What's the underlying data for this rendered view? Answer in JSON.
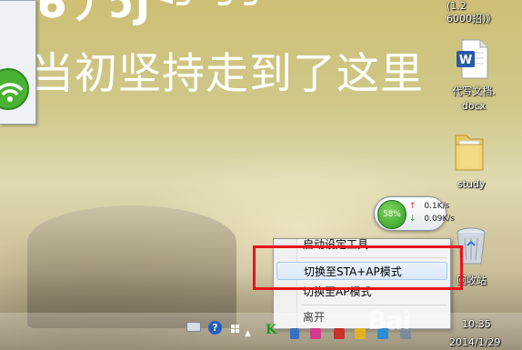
{
  "wallpaper": {
    "headline_partial": "ᑲ丿ɔJᑉ╯ ╯╯",
    "slogan": "当初坚持走到了这里"
  },
  "desktop": {
    "top_right_label_line1": "(1.2",
    "top_right_label_line2": "6000招)》",
    "icons": [
      {
        "label_line1": "代写文档.",
        "label_line2": "docx",
        "icon": "word-document-icon"
      },
      {
        "label_line1": "study",
        "icon": "folder-icon"
      },
      {
        "label_line1": "回收站",
        "icon": "recycle-bin-icon"
      }
    ]
  },
  "network_widget": {
    "percent": "58%",
    "upload": "0.1K/s",
    "download": "0.09K/s",
    "colors": {
      "ring": "#2c9a22",
      "up_arrow": "#e02020",
      "down_arrow": "#2e9d2e"
    }
  },
  "context_menu": {
    "items": [
      {
        "label": "启动设定工具",
        "highlight": false
      },
      {
        "label": "切换至STA+AP模式",
        "highlight": true
      },
      {
        "label": "切换至AP模式",
        "highlight": false
      },
      {
        "label": "离开",
        "highlight": false
      }
    ],
    "highlight_box_color": "#e8141c"
  },
  "taskbar": {
    "clock_time": "10:35",
    "clock_date": "2014/1/29",
    "tray_icons": [
      "keyboard-icon",
      "help-icon",
      "windows-flag-icon",
      "show-hidden-icons-chevron",
      "network-k-icon",
      "app-icon-1",
      "app-icon-2",
      "app-icon-3",
      "app-icon-4",
      "app-icon-5",
      "app-icon-6"
    ]
  },
  "watermark": {
    "text": "Bai"
  }
}
